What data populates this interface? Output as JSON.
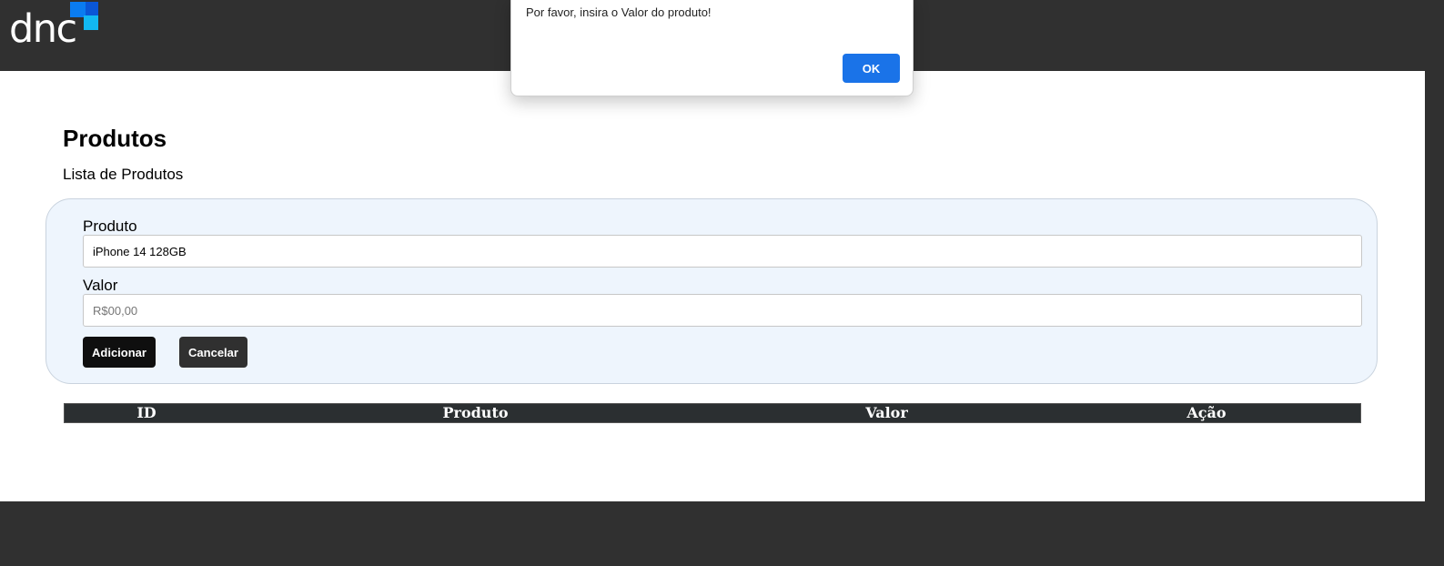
{
  "header": {
    "logo_text": "dnc"
  },
  "main": {
    "title": "Produtos",
    "subtitle": "Lista de Produtos"
  },
  "form": {
    "produto_label": "Produto",
    "produto_value": "iPhone 14 128GB",
    "valor_label": "Valor",
    "valor_placeholder": "R$00,00",
    "add_button": "Adicionar",
    "cancel_button": "Cancelar"
  },
  "table": {
    "columns": [
      "ID",
      "Produto",
      "Valor",
      "Ação"
    ]
  },
  "alert": {
    "message": "Por favor, insira o Valor do produto!",
    "ok_label": "OK"
  },
  "colors": {
    "header_bg": "#303030",
    "logo_blue": "#0a7cf0",
    "logo_cyan": "#12b8f2",
    "form_bg": "#eef5fd",
    "primary_button": "#0f0f0f",
    "secondary_button": "#303030",
    "table_header_bg": "#2b2f31",
    "alert_button": "#1a73e8"
  }
}
